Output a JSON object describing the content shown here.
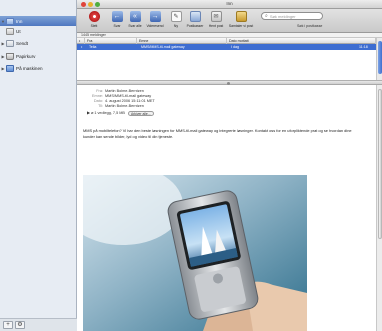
{
  "window": {
    "title": "Inn"
  },
  "colors": {
    "selection": "#3d6dd1",
    "sidebar_bg": "#e7ecf3",
    "close": "#e0443a",
    "minimize": "#e8b12d",
    "zoom": "#4fae3e"
  },
  "sidebar": {
    "items": [
      {
        "label": "Inn",
        "icon": "inbox-icon",
        "selected": true
      },
      {
        "label": "Ut",
        "icon": "outbox-icon",
        "selected": false
      },
      {
        "label": "Sendt",
        "icon": "sent-icon",
        "selected": false
      },
      {
        "label": "Papirkurv",
        "icon": "trash-icon",
        "selected": false
      },
      {
        "label": "På maskinen",
        "icon": "folder-icon",
        "selected": false
      }
    ],
    "add_button": "+",
    "action_button": "⚙"
  },
  "toolbar": {
    "buttons": [
      {
        "label": "Slett",
        "icon": "delete-icon"
      },
      {
        "label": "Svar",
        "icon": "reply-icon"
      },
      {
        "label": "Svar alle",
        "icon": "reply-all-icon"
      },
      {
        "label": "Videresend",
        "icon": "forward-icon"
      },
      {
        "label": "Ny",
        "icon": "new-message-icon"
      },
      {
        "label": "Postkasser",
        "icon": "mailboxes-icon"
      },
      {
        "label": "Hent post",
        "icon": "get-mail-icon"
      },
      {
        "label": "Samtaler vi post",
        "icon": "notes-icon"
      }
    ],
    "search_placeholder": "Søk meldinger",
    "scope_label": "Søk i postkasse"
  },
  "message_list": {
    "status": "1445 meldinger",
    "columns": [
      "•",
      "Fra",
      "Emne",
      "Dato mottatt"
    ],
    "rows": [
      {
        "dot": "•",
        "from": "Telia",
        "subject": "MMS/MMS-til-mail gateway",
        "date": "I dag",
        "time": "11:18",
        "selected": true
      }
    ]
  },
  "preview": {
    "from_key": "Fra:",
    "from": "Martin Bolme-Berntzen",
    "subject_key": "Emne:",
    "subject": "MMS/MMS-til-mail gateway",
    "date_key": "Dato:",
    "date": "4. august 2006 15:11:01 MET",
    "to_key": "Til:",
    "to": "Martin Bolme-Berntzen",
    "attachment_summary": "1 vedlegg, 7,5 MB",
    "attachment_button": "Arkiver alle...",
    "body": "MMS på mobiltelefon? Vi har den beste løsningen for MMS-til-mail gateway og integrerte løsninger. Kontakt oss for en uforpliktende prat og se hvordan dine kunder kan sende bilder, lyd og video til din tjeneste."
  }
}
